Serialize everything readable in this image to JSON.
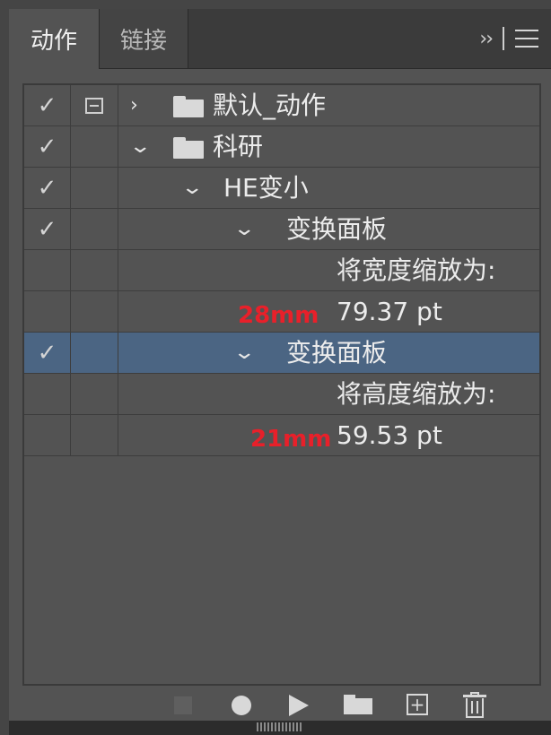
{
  "tabs": [
    {
      "label": "动作",
      "active": true
    },
    {
      "label": "链接",
      "active": false
    }
  ],
  "tab_tools": {
    "expand": "››"
  },
  "rows": [
    {
      "check": "✓",
      "dialog": true,
      "chevron": "›",
      "folder": true,
      "label": "默认_动作",
      "annotation": ""
    },
    {
      "check": "✓",
      "dialog": false,
      "chevron": "⌄",
      "folder": true,
      "label": "科研",
      "annotation": ""
    },
    {
      "check": "✓",
      "dialog": false,
      "chevron": "⌄",
      "folder": false,
      "label": "HE变小",
      "annotation": ""
    },
    {
      "check": "✓",
      "dialog": false,
      "chevron": "⌄",
      "folder": false,
      "label": "变换面板",
      "annotation": ""
    },
    {
      "check": "",
      "dialog": false,
      "chevron": "",
      "folder": false,
      "label": "将宽度缩放为:",
      "annotation": ""
    },
    {
      "check": "",
      "dialog": false,
      "chevron": "",
      "folder": false,
      "label": "79.37 pt",
      "annotation": "28mm"
    },
    {
      "check": "✓",
      "dialog": false,
      "chevron": "⌄",
      "folder": false,
      "label": "变换面板",
      "annotation": "",
      "selected": true
    },
    {
      "check": "",
      "dialog": false,
      "chevron": "",
      "folder": false,
      "label": "将高度缩放为:",
      "annotation": ""
    },
    {
      "check": "",
      "dialog": false,
      "chevron": "",
      "folder": false,
      "label": "59.53 pt",
      "annotation": "21mm"
    }
  ],
  "bottom_icons": [
    "stop-icon",
    "record-icon",
    "play-icon",
    "new-set-folder-icon",
    "new-action-icon",
    "trash-icon"
  ],
  "colors": {
    "selection": "#4b6583",
    "annotation": "#e8202a",
    "panel": "#535353"
  }
}
